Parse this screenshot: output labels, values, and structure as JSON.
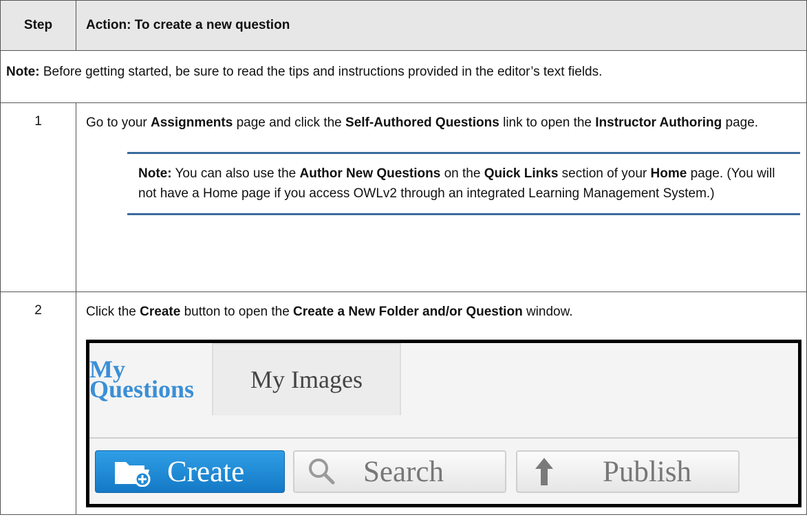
{
  "table": {
    "header": {
      "step": "Step",
      "action": "Action: To create a new question"
    },
    "note": {
      "label": "Note:",
      "text": " Before getting started, be sure to read the tips and instructions provided in the editor’s text fields."
    },
    "rows": [
      {
        "num": "1",
        "text": [
          "Go to your ",
          "Assignments",
          " page and click the ",
          "Self-Authored Questions",
          " link to open the ",
          "Instructor Authoring",
          " page."
        ],
        "callout": [
          "Note:",
          " You can also use the ",
          "Author New Questions",
          " on the ",
          "Quick Links",
          " section of your ",
          "Home",
          " page. (You will not have a Home page if you access OWLv2 through an integrated Learning Management System.)"
        ]
      },
      {
        "num": "2",
        "text": [
          "Click the ",
          "Create",
          " button to open the ",
          "Create a New Folder and/or Question",
          " window."
        ]
      }
    ]
  },
  "screenshot": {
    "tabs": [
      {
        "label": "My Questions",
        "active": true
      },
      {
        "label": "My Images",
        "active": false
      }
    ],
    "buttons": [
      {
        "label": "Create",
        "icon": "folder-add-icon"
      },
      {
        "label": "Search",
        "icon": "search-icon"
      },
      {
        "label": "Publish",
        "icon": "arrow-up-icon"
      }
    ]
  },
  "colors": {
    "header_bg": "#e7e7e7",
    "callout_rule": "#3a6a9c",
    "create_blue": "#1e8ad8",
    "tab_active": "#3b8fd6"
  }
}
